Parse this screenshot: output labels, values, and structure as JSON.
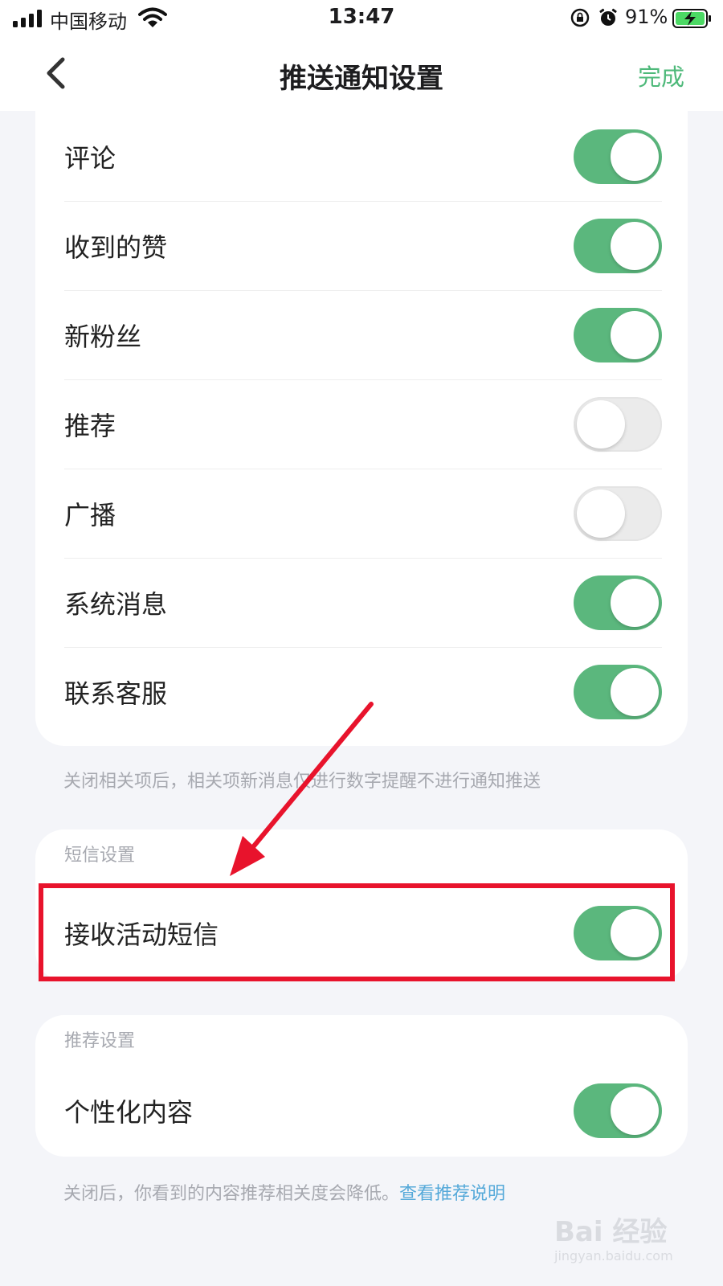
{
  "status_bar": {
    "carrier": "中国移动",
    "time": "13:47",
    "battery_percent": "91%",
    "icons": [
      "signal-icon",
      "wifi-icon",
      "orientation-lock-icon",
      "alarm-icon",
      "battery-charging-icon"
    ]
  },
  "nav": {
    "title": "推送通知设置",
    "done_label": "完成",
    "back_icon": "chevron-left-icon"
  },
  "notification_items": [
    {
      "label": "评论",
      "enabled": true
    },
    {
      "label": "收到的赞",
      "enabled": true
    },
    {
      "label": "新粉丝",
      "enabled": true
    },
    {
      "label": "推荐",
      "enabled": false
    },
    {
      "label": "广播",
      "enabled": false
    },
    {
      "label": "系统消息",
      "enabled": true
    },
    {
      "label": "联系客服",
      "enabled": true
    }
  ],
  "notification_note": "关闭相关项后，相关项新消息仅进行数字提醒不进行通知推送",
  "sms_section": {
    "title": "短信设置",
    "item": {
      "label": "接收活动短信",
      "enabled": true
    }
  },
  "recommend_section": {
    "title": "推荐设置",
    "item": {
      "label": "个性化内容",
      "enabled": true
    },
    "note": "关闭后，你看到的内容推荐相关度会降低。",
    "link": "查看推荐说明"
  },
  "annotation": {
    "color": "#e8132c"
  },
  "watermark": {
    "brand": "Bai 经验",
    "site": "jingyan.baidu.com"
  },
  "colors": {
    "accent_green": "#5bb77d",
    "done_green": "#4eb97a",
    "link_blue": "#55a9d9",
    "background": "#f4f5f9"
  }
}
